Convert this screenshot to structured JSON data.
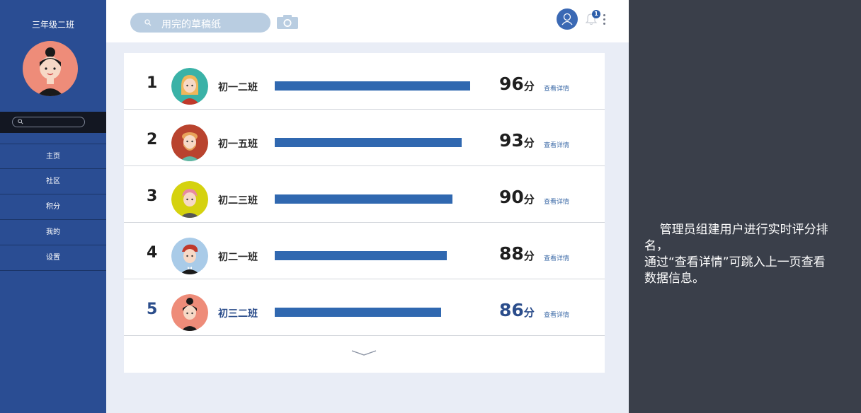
{
  "sidebar": {
    "class_title": "三年级二班",
    "search_placeholder": "",
    "items": [
      {
        "label": "主页"
      },
      {
        "label": "社区"
      },
      {
        "label": "积分"
      },
      {
        "label": "我的"
      },
      {
        "label": "设置"
      }
    ]
  },
  "topbar": {
    "search_value": "用完的草稿纸",
    "notification_count": "1"
  },
  "ranking": {
    "detail_label": "查看详情",
    "score_unit": "分",
    "rows": [
      {
        "rank": "1",
        "class_name": "初一二班",
        "score": "96",
        "bar_fraction": 0.96,
        "avatar": "girl-teal-avatar",
        "avatar_color": "#3ab2a7"
      },
      {
        "rank": "2",
        "class_name": "初一五班",
        "score": "93",
        "bar_fraction": 0.93,
        "avatar": "bearded-man-avatar",
        "avatar_color": "#b9432e"
      },
      {
        "rank": "3",
        "class_name": "初二三班",
        "score": "90",
        "bar_fraction": 0.9,
        "avatar": "pink-hair-avatar",
        "avatar_color": "#d5d20f"
      },
      {
        "rank": "4",
        "class_name": "初二一班",
        "score": "88",
        "bar_fraction": 0.88,
        "avatar": "red-hair-man-avatar",
        "avatar_color": "#a9cbe8"
      },
      {
        "rank": "5",
        "class_name": "初三二班",
        "score": "86",
        "bar_fraction": 0.86,
        "avatar": "bun-girl-avatar",
        "avatar_color": "#ee8c79",
        "highlight": true
      }
    ]
  },
  "annotation": {
    "line1": "    管理员组建用户进行实时评分排名，",
    "line2": "通过“查看详情”可跳入上一页查看数据信息。"
  },
  "colors": {
    "sidebar": "#2a4d93",
    "bar": "#3068b0",
    "highlight_text": "#2b4d8b",
    "annotation_bg": "#3a3f4a"
  }
}
